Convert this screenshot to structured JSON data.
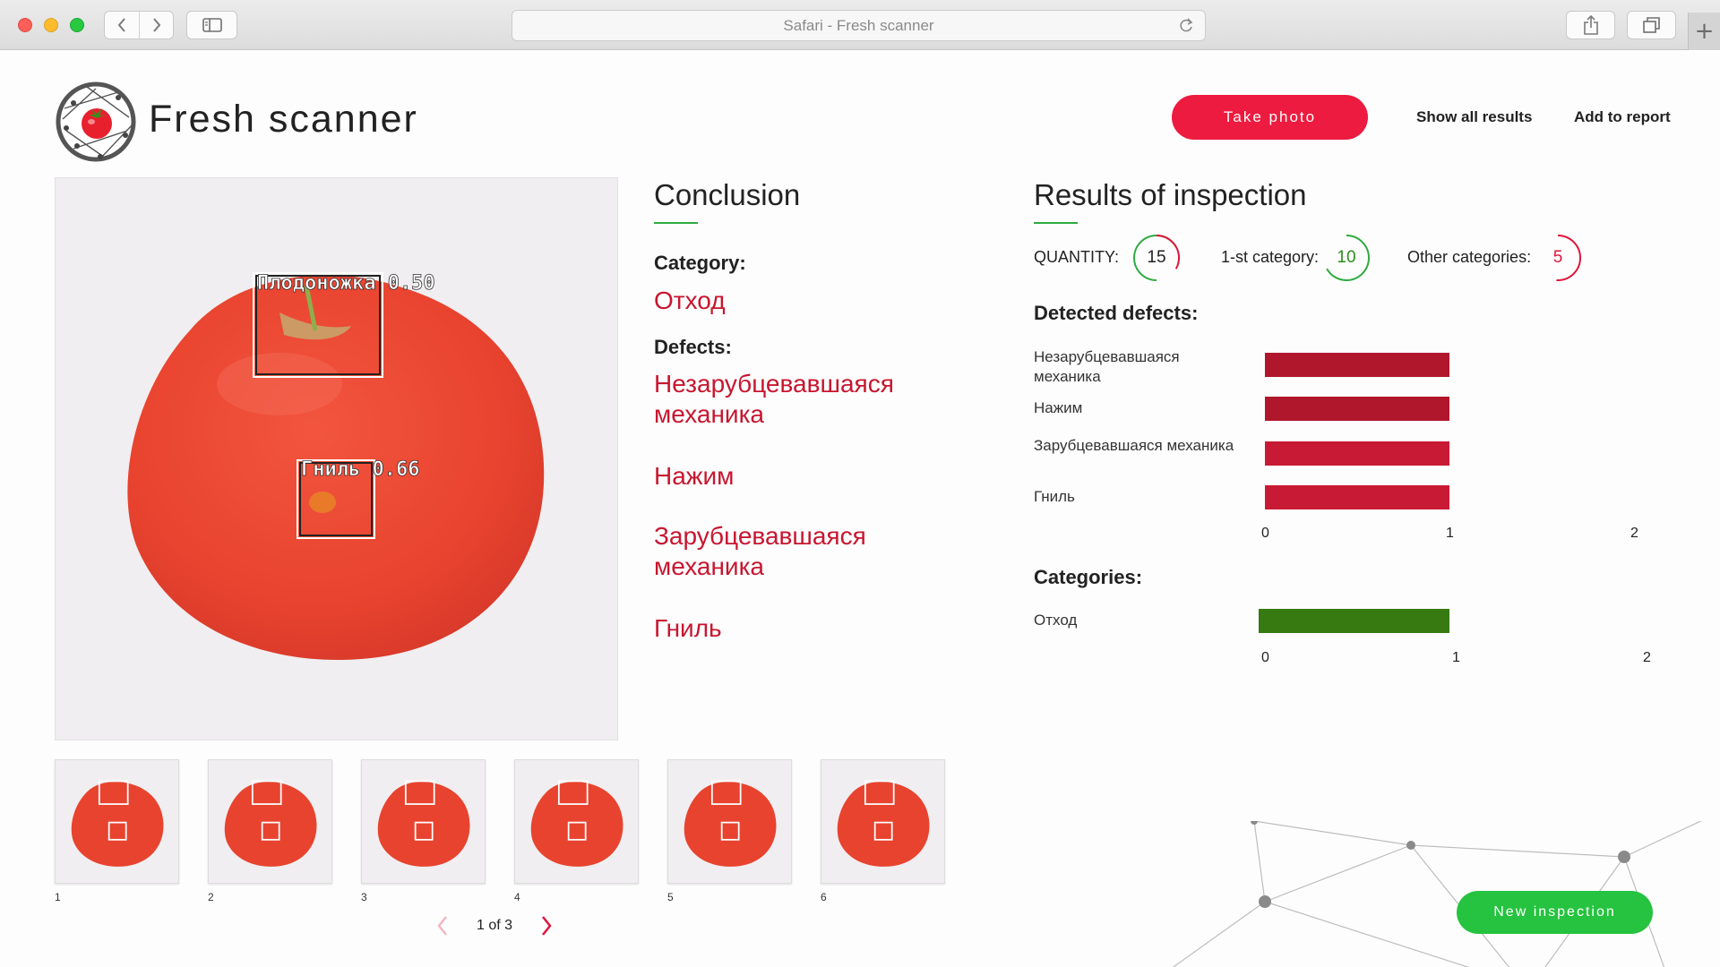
{
  "window": {
    "title": "Safari - Fresh scanner"
  },
  "header": {
    "brand": "Fresh scanner",
    "take_photo": "Take photo",
    "show_all_results": "Show all results",
    "add_to_report": "Add to report"
  },
  "image": {
    "detections": [
      {
        "label": "Плодоножка 0.50"
      },
      {
        "label": "Гниль 0.66"
      }
    ]
  },
  "thumbnails": [
    "1",
    "2",
    "3",
    "4",
    "5",
    "6"
  ],
  "pager": {
    "text": "1 of 3"
  },
  "conclusion": {
    "title": "Conclusion",
    "category_label": "Category:",
    "category_value": "Отход",
    "defects_label": "Defects:",
    "defects": [
      "Незарубцевавшаяся механика",
      "Нажим",
      "Зарубцевавшаяся механика",
      "Гниль"
    ]
  },
  "results": {
    "title": "Results of inspection",
    "quantity_label": "QUANTITY:",
    "quantity_value": "15",
    "first_category_label": "1-st category:",
    "first_category_value": "10",
    "other_categories_label": "Other categories:",
    "other_categories_value": "5",
    "detected_defects_label": "Detected defects:",
    "categories_label": "Categories:",
    "colors": {
      "defect_bar": "#b0172c",
      "defect_bar_light": "#c91a35",
      "category_bar": "#377a12",
      "accent_red": "#ed1b3f",
      "accent_green": "#25c33f"
    }
  },
  "chart_data": [
    {
      "type": "bar",
      "orientation": "horizontal",
      "title": "Detected defects:",
      "categories": [
        "Незарубцевавшаяся механика",
        "Нажим",
        "Зарубцевавшаяся механика",
        "Гниль"
      ],
      "values": [
        1,
        1,
        1,
        1
      ],
      "xlim": [
        0,
        2
      ],
      "ticks": [
        "0",
        "1",
        "2"
      ]
    },
    {
      "type": "bar",
      "orientation": "horizontal",
      "title": "Categories:",
      "categories": [
        "Отход"
      ],
      "values": [
        1
      ],
      "xlim": [
        0,
        2
      ],
      "ticks": [
        "0",
        "1",
        "2"
      ]
    }
  ],
  "footer": {
    "new_inspection": "New inspection"
  }
}
